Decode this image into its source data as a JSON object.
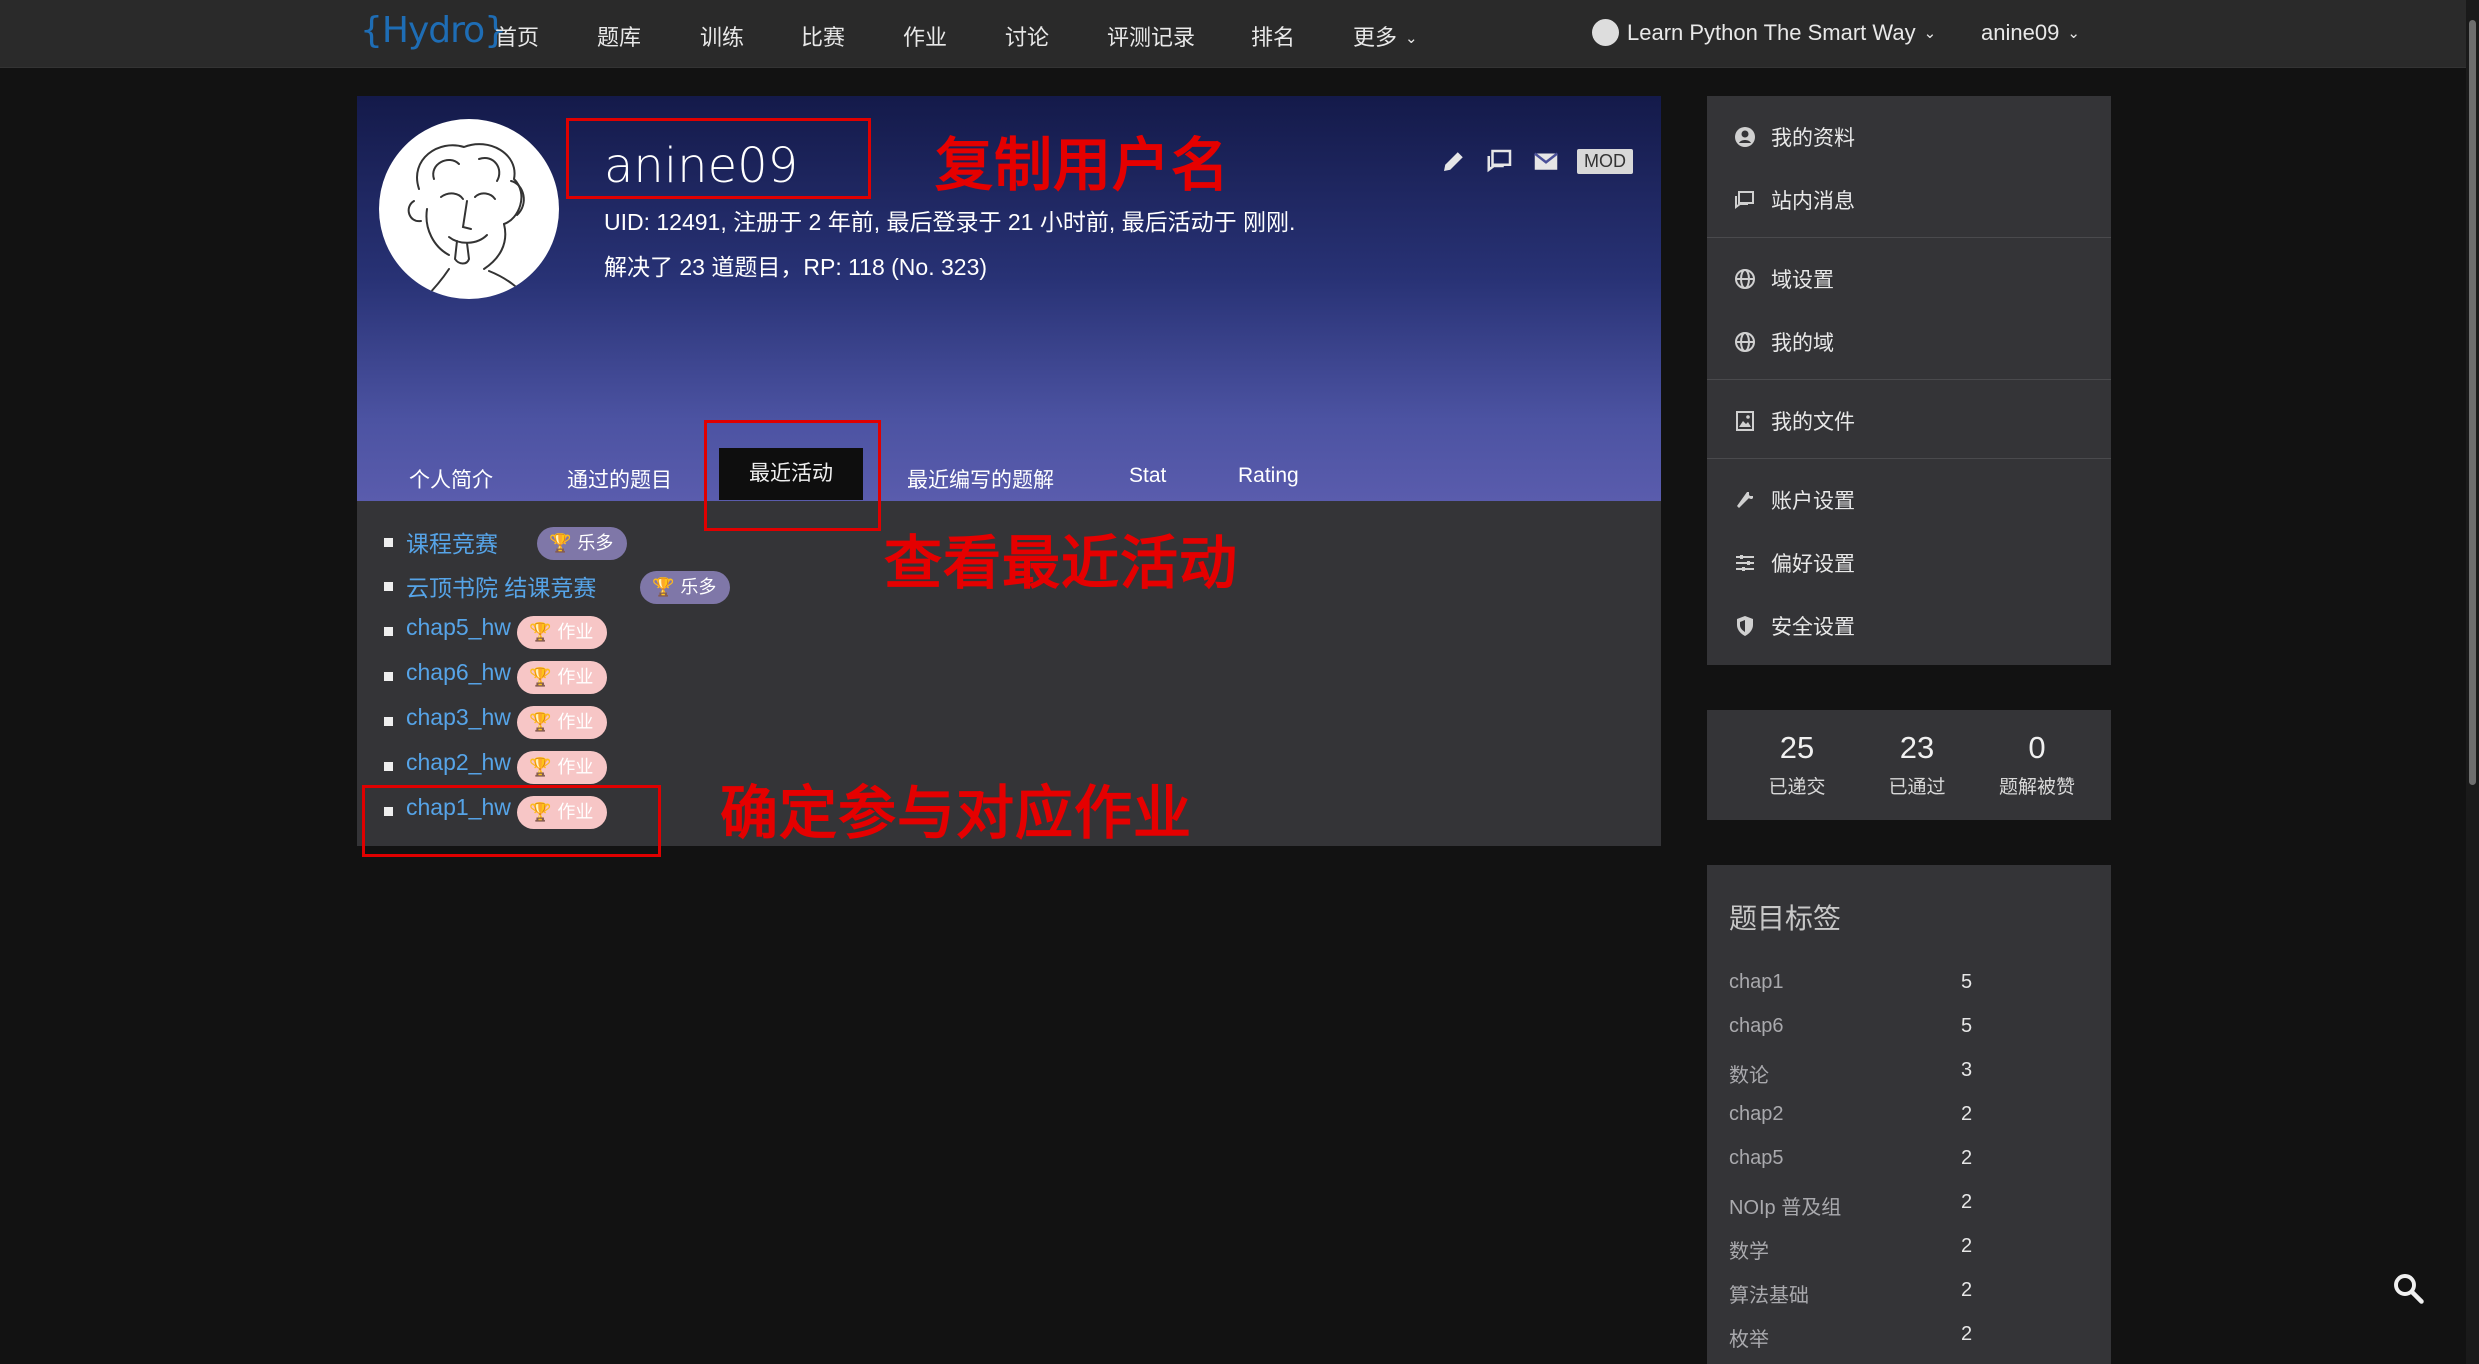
{
  "nav": {
    "logo": "{Hydro}",
    "items": [
      "首页",
      "题库",
      "训练",
      "比赛",
      "作业",
      "讨论",
      "评测记录",
      "排名",
      "更多"
    ],
    "domain": "Learn Python The Smart Way",
    "user": "anine09"
  },
  "profile": {
    "username": "anine09",
    "meta_line1": "UID: 12491, 注册于 2 年前, 最后登录于 21 小时前, 最后活动于 刚刚.",
    "meta_line2": "解决了 23 道题目，RP: 118 (No. 323)",
    "mod_badge": "MOD",
    "tabs": [
      "个人简介",
      "通过的题目",
      "最近活动",
      "最近编写的题解",
      "Stat",
      "Rating"
    ],
    "active_tab": "最近活动"
  },
  "activities": [
    {
      "name": "课程竞赛",
      "badge": "乐多",
      "badge_kind": "purple"
    },
    {
      "name": "云顶书院 结课竞赛",
      "badge": "乐多",
      "badge_kind": "purple"
    },
    {
      "name": "chap5_hw",
      "badge": "作业",
      "badge_kind": "pink"
    },
    {
      "name": "chap6_hw",
      "badge": "作业",
      "badge_kind": "pink"
    },
    {
      "name": "chap3_hw",
      "badge": "作业",
      "badge_kind": "pink"
    },
    {
      "name": "chap2_hw",
      "badge": "作业",
      "badge_kind": "pink"
    },
    {
      "name": "chap1_hw",
      "badge": "作业",
      "badge_kind": "pink"
    }
  ],
  "annotations": {
    "copy_username": "复制用户名",
    "view_recent": "查看最近活动",
    "confirm_homework": "确定参与对应作业"
  },
  "sidebar": {
    "menu": [
      "我的资料",
      "站内消息",
      "域设置",
      "我的域",
      "我的文件",
      "账户设置",
      "偏好设置",
      "安全设置"
    ],
    "stats": [
      {
        "value": "25",
        "label": "已递交"
      },
      {
        "value": "23",
        "label": "已通过"
      },
      {
        "value": "0",
        "label": "题解被赞"
      }
    ],
    "tags_title": "题目标签",
    "tags": [
      {
        "name": "chap1",
        "count": "5"
      },
      {
        "name": "chap6",
        "count": "5"
      },
      {
        "name": "数论",
        "count": "3"
      },
      {
        "name": "chap2",
        "count": "2"
      },
      {
        "name": "chap5",
        "count": "2"
      },
      {
        "name": "NOIp 普及组",
        "count": "2"
      },
      {
        "name": "数学",
        "count": "2"
      },
      {
        "name": "算法基础",
        "count": "2"
      },
      {
        "name": "枚举",
        "count": "2"
      }
    ]
  },
  "colors": {
    "link": "#56a4e8",
    "annotation_red": "#e00000",
    "badge_purple": "#7f77a8",
    "badge_pink": "#f7c6c6"
  }
}
